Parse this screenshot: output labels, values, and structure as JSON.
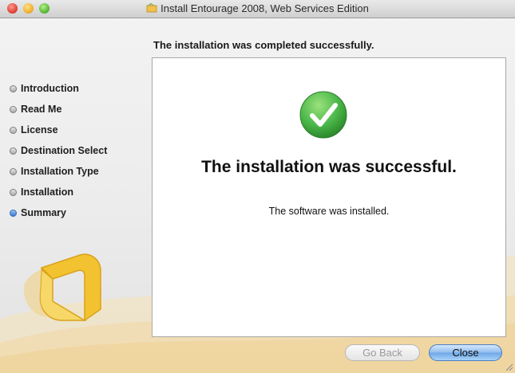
{
  "window": {
    "title": "Install Entourage 2008, Web Services Edition",
    "heading": "The installation was completed successfully."
  },
  "steps": [
    {
      "label": "Introduction",
      "active": false
    },
    {
      "label": "Read Me",
      "active": false
    },
    {
      "label": "License",
      "active": false
    },
    {
      "label": "Destination Select",
      "active": false
    },
    {
      "label": "Installation Type",
      "active": false
    },
    {
      "label": "Installation",
      "active": false
    },
    {
      "label": "Summary",
      "active": true
    }
  ],
  "content": {
    "title": "The installation was successful.",
    "message": "The software was installed.",
    "icon": "checkmark-icon"
  },
  "buttons": {
    "back": "Go Back",
    "close": "Close"
  },
  "colors": {
    "accent": "#3a76cf",
    "success": "#4cb84a",
    "brand": "#f2c230"
  }
}
